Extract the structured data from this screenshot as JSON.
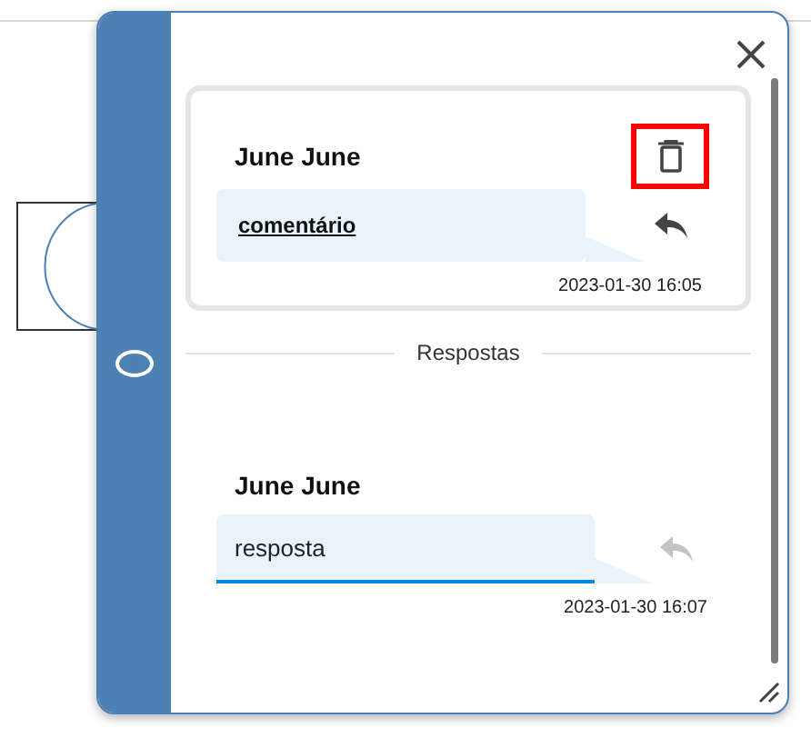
{
  "comment": {
    "author": "June June",
    "text": "comentário",
    "timestamp": "2023-01-30 16:05",
    "delete_highlighted": true,
    "reply_disabled": false
  },
  "replies_heading": "Respostas",
  "reply": {
    "author": "June June",
    "value": "resposta",
    "timestamp": "2023-01-30 16:07",
    "reply_disabled": true
  }
}
